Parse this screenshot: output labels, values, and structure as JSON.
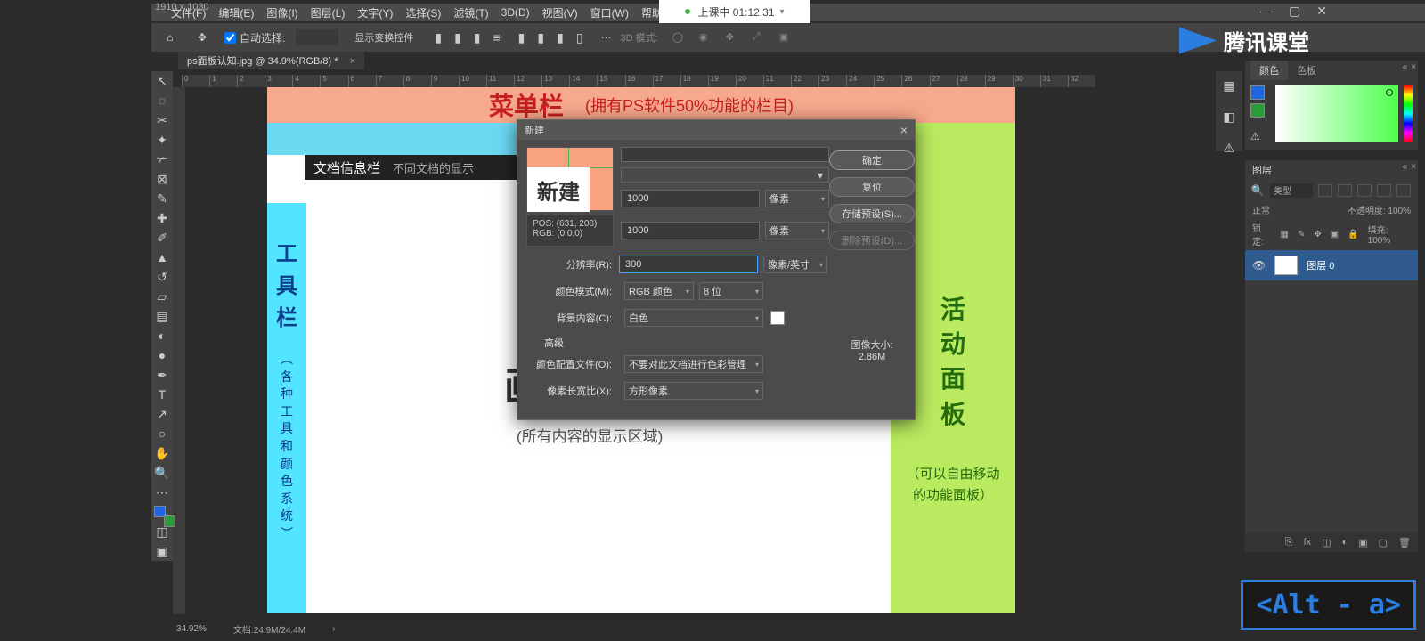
{
  "resolution": "1910 x 1030",
  "menu": [
    "文件(F)",
    "编辑(E)",
    "图像(I)",
    "图层(L)",
    "文字(Y)",
    "选择(S)",
    "滤镜(T)",
    "3D(D)",
    "视图(V)",
    "窗口(W)",
    "帮助(H)"
  ],
  "class_tab": {
    "label": "上课中 01:12:31"
  },
  "options": {
    "auto_select": "自动选择:",
    "show_transform": "显示变换控件",
    "d3_mode": "3D 模式:"
  },
  "doc_tab": "ps面板认知.jpg @ 34.9%(RGB/8) *",
  "ruler_h": [
    "0",
    "1",
    "2",
    "3",
    "4",
    "5",
    "6",
    "7",
    "8",
    "9",
    "10",
    "11",
    "12",
    "13",
    "14",
    "15",
    "16",
    "17",
    "18",
    "19",
    "20",
    "21",
    "22",
    "23",
    "24",
    "25",
    "26",
    "27",
    "28",
    "29",
    "30",
    "31",
    "32"
  ],
  "canvas": {
    "menu_bar_title": "菜单栏",
    "menu_bar_sub": "(拥有PS软件50%功能的栏目)",
    "doc_info_bar": "文档信息栏",
    "doc_info_sub": "不同文档的显示",
    "toolbar_title": "工\n具\n栏",
    "toolbar_sub": "︵\n各\n种\n工\n具\n和\n颜\n色\n系\n统\n︶",
    "activity_title": "活\n动\n面\n板",
    "activity_sub": "（可以自由移动\n的功能面板）",
    "center": "(所有内容的显示区域)",
    "partial": "画"
  },
  "dialog": {
    "title": "新建",
    "thumb_text": "新建",
    "pos_label": "POS:",
    "pos_val": "(631, 208)",
    "rgb_label": "RGB:",
    "rgb_val": "(0,0,0)",
    "width": "1000",
    "height": "1000",
    "res_label": "分辨率(R):",
    "res": "300",
    "unit_px": "像素",
    "unit_ppi": "像素/英寸",
    "mode_label": "颜色模式(M):",
    "mode": "RGB 颜色",
    "bits": "8 位",
    "bg_label": "背景内容(C):",
    "bg": "白色",
    "adv": "高级",
    "profile_label": "颜色配置文件(O):",
    "profile": "不要对此文档进行色彩管理",
    "aspect_label": "像素长宽比(X):",
    "aspect": "方形像素",
    "btn_ok": "确定",
    "btn_reset": "复位",
    "btn_save": "存储预设(S)...",
    "btn_delete": "删除预设(D)...",
    "imgsize_label": "图像大小:",
    "imgsize": "2.86M"
  },
  "color_panel": {
    "tab1": "颜色",
    "tab2": "色板"
  },
  "layer_panel": {
    "tab": "图层",
    "type": "类型",
    "mode": "正常",
    "opacity_label": "不透明度:",
    "opacity": "100%",
    "lock_label": "锁定:",
    "fill_label": "填充:",
    "fill": "100%",
    "layer_name": "图层 0"
  },
  "status": {
    "zoom": "34.92%",
    "doc": "文档:24.9M/24.4M"
  },
  "alt_key": "<Alt - a>",
  "brand": "腾讯课堂"
}
